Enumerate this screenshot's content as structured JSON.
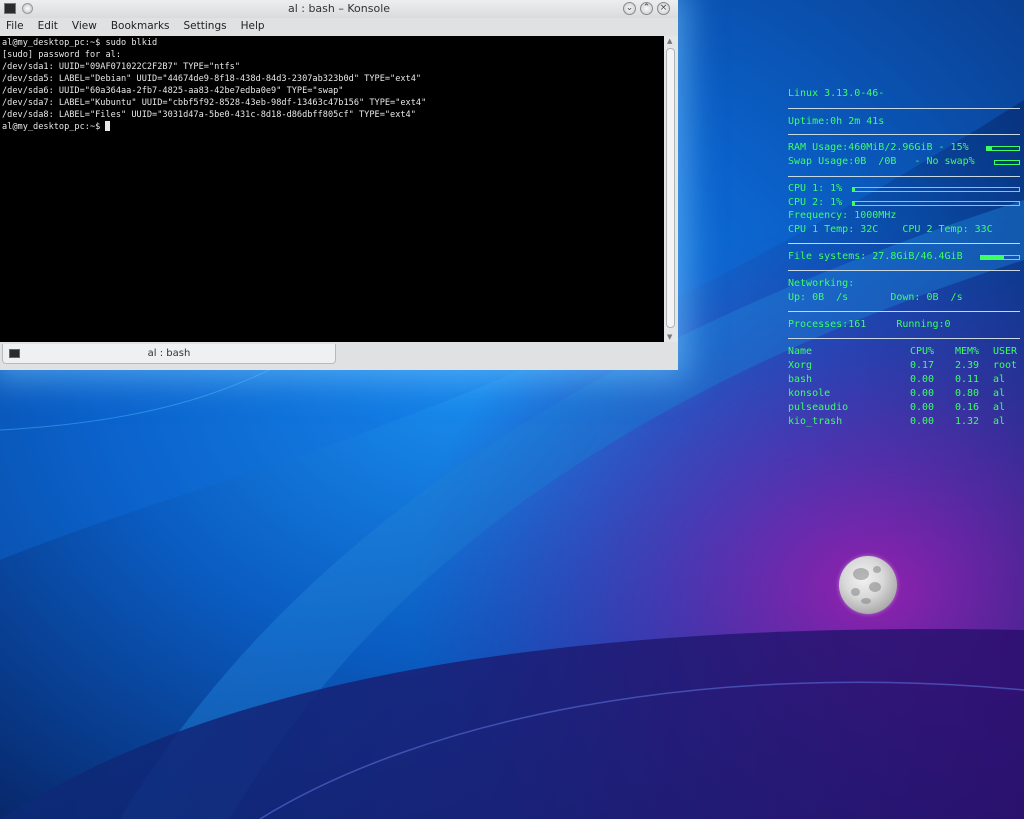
{
  "window": {
    "title": "al : bash – Konsole",
    "menu": [
      "File",
      "Edit",
      "View",
      "Bookmarks",
      "Settings",
      "Help"
    ],
    "terminal_lines": [
      "al@my_desktop_pc:~$ sudo blkid",
      "[sudo] password for al:",
      "/dev/sda1: UUID=\"09AF071022C2F2B7\" TYPE=\"ntfs\"",
      "/dev/sda5: LABEL=\"Debian\" UUID=\"44674de9-8f18-438d-84d3-2307ab323b0d\" TYPE=\"ext4\"",
      "/dev/sda6: UUID=\"60a364aa-2fb7-4825-aa83-42be7edba0e9\" TYPE=\"swap\"",
      "/dev/sda7: LABEL=\"Kubuntu\" UUID=\"cbbf5f92-8528-43eb-98df-13463c47b156\" TYPE=\"ext4\"",
      "/dev/sda8: LABEL=\"Files\" UUID=\"3031d47a-5be0-431c-8d18-d86dbff805cf\" TYPE=\"ext4\""
    ],
    "prompt": "al@my_desktop_pc:~$ ",
    "tab_label": "al : bash"
  },
  "conky": {
    "kernel": "Linux 3.13.0-46-",
    "uptime": "Uptime:0h 2m 41s",
    "ram": "RAM Usage:460MiB/2.96GiB - 15%",
    "ram_fraction": 0.15,
    "swap": "Swap Usage:0B  /0B   - No swap%",
    "swap_fraction": 0,
    "cpu1": "CPU 1: 1%",
    "cpu1_fraction": 0.01,
    "cpu2": "CPU 2: 1%",
    "cpu2_fraction": 0.01,
    "frequency": "Frequency: 1000MHz",
    "temps": "CPU 1 Temp: 32C    CPU 2 Temp: 33C",
    "filesystems": "File systems: 27.8GiB/46.4GiB",
    "fs_fraction": 0.6,
    "networking": "Networking:",
    "net_speed": "Up: 0B  /s       Down: 0B  /s",
    "processes": "Processes:161     Running:0",
    "proc_headers": [
      "Name",
      "CPU%",
      "MEM%",
      "USER"
    ],
    "proc_rows": [
      [
        "Xorg",
        "0.17",
        "2.39",
        "root"
      ],
      [
        "bash",
        "0.00",
        "0.11",
        "al"
      ],
      [
        "konsole",
        "0.00",
        "0.80",
        "al"
      ],
      [
        "pulseaudio",
        "0.00",
        "0.16",
        "al"
      ],
      [
        "kio_trash",
        "0.00",
        "1.32",
        "al"
      ]
    ],
    "color": "#3dff62"
  },
  "icons": [
    "konsole-icon",
    "pin-icon",
    "minimize-icon",
    "maximize-icon",
    "close-icon",
    "moon-icon"
  ]
}
